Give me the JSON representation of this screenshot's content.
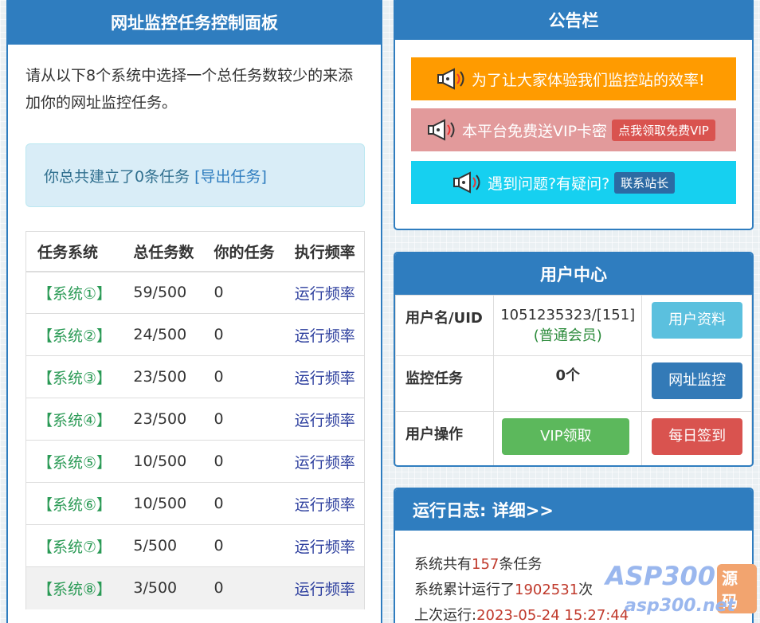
{
  "left_panel": {
    "title": "网址监控任务控制面板",
    "intro": "请从以下8个系统中选择一个总任务数较少的来添加你的网址监控任务。",
    "alert_text": "你总共建立了0条任务 ",
    "alert_link": "[导出任务]",
    "table": {
      "headers": [
        "任务系统",
        "总任务数",
        "你的任务",
        "执行频率"
      ],
      "rows": [
        {
          "system": "【系统①】",
          "total": "59/500",
          "mine": "0",
          "freq": "运行频率"
        },
        {
          "system": "【系统②】",
          "total": "24/500",
          "mine": "0",
          "freq": "运行频率"
        },
        {
          "system": "【系统③】",
          "total": "23/500",
          "mine": "0",
          "freq": "运行频率"
        },
        {
          "system": "【系统④】",
          "total": "23/500",
          "mine": "0",
          "freq": "运行频率"
        },
        {
          "system": "【系统⑤】",
          "total": "10/500",
          "mine": "0",
          "freq": "运行频率"
        },
        {
          "system": "【系统⑥】",
          "total": "10/500",
          "mine": "0",
          "freq": "运行频率"
        },
        {
          "system": "【系统⑦】",
          "total": "5/500",
          "mine": "0",
          "freq": "运行频率"
        },
        {
          "system": "【系统⑧】",
          "total": "3/500",
          "mine": "0",
          "freq": "运行频率"
        }
      ]
    }
  },
  "notice": {
    "title": "公告栏",
    "bar1": "为了让大家体验我们监控站的效率!",
    "bar2": "本平台免费送VIP卡密",
    "bar2_button": "点我领取免费VIP",
    "bar3": "遇到问题?有疑问?",
    "bar3_button": "联系站长",
    "icon": "megaphone-icon"
  },
  "user_center": {
    "title": "用户中心",
    "row1_label": "用户名/UID",
    "uid": "1051235323/[151]",
    "level": "(普通会员)",
    "profile_button": "用户资料",
    "row2_label": "监控任务",
    "task_count": "0个",
    "monitor_button": "网址监控",
    "row3_label": "用户操作",
    "vip_button": "VIP领取",
    "checkin_button": "每日签到"
  },
  "log": {
    "title": "运行日志: 详细>>",
    "line1_pre": "系统共有",
    "line1_num": "157",
    "line1_post": "条任务",
    "line2_pre": "系统累计运行了",
    "line2_num": "1902531",
    "line2_post": "次",
    "line3_pre": "上次运行:",
    "line3_num": "2023-05-24 15:27:44"
  },
  "watermark": {
    "brand": "ASP300",
    "tag": "源码",
    "site": "asp300.net"
  },
  "colors": {
    "primary": "#2f7dbf",
    "orange": "#ff9b00",
    "pink": "#e29a9b",
    "cyan": "#16d0f0",
    "green": "#5cb85c",
    "red": "#d9534f"
  }
}
